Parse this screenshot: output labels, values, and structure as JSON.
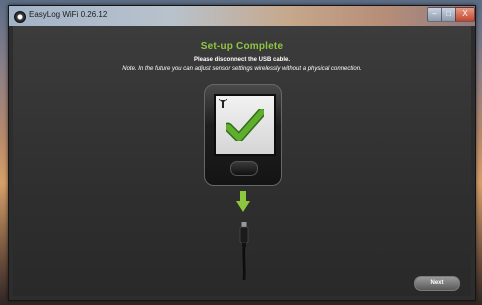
{
  "window": {
    "title": "EasyLog WiFi 0.26.12",
    "controls": {
      "minimize": "–",
      "maximize": "□",
      "close": "X"
    }
  },
  "main": {
    "heading": "Set-up Complete",
    "instruction": "Please disconnect the USB cable.",
    "note": "Note. In the future you can adjust sensor settings wirelessly without a physical connection."
  },
  "illustration": {
    "icons": [
      "device-icon",
      "signal-icon",
      "checkmark-icon",
      "down-arrow-icon",
      "usb-cable-icon"
    ],
    "colors": {
      "accent": "#8ec63f",
      "check": "#5fae2e"
    }
  },
  "footer": {
    "next_label": "Next"
  }
}
